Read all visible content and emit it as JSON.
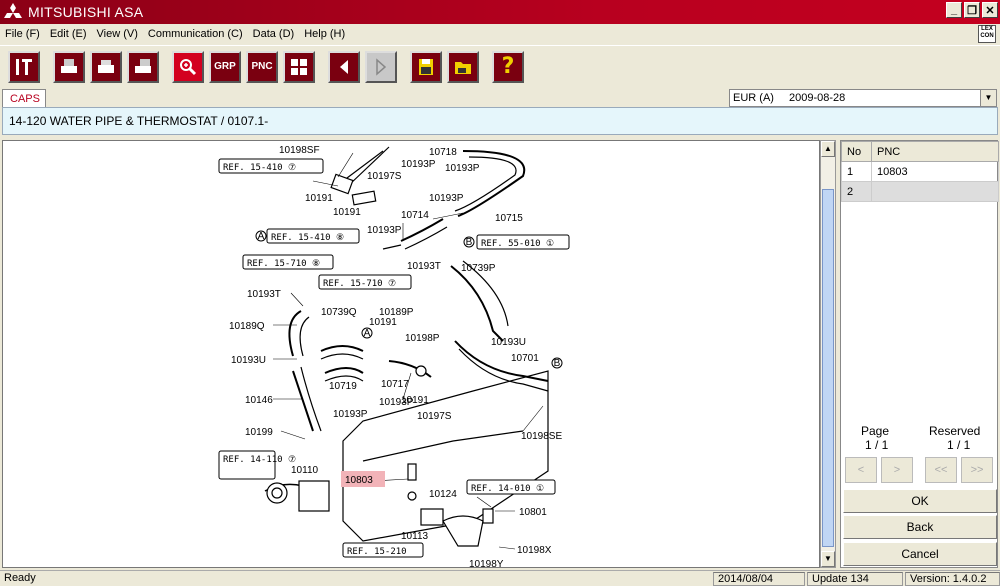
{
  "window": {
    "title": "MITSUBISHI ASA"
  },
  "menu": [
    "File (F)",
    "Edit (E)",
    "View (V)",
    "Communication (C)",
    "Data (D)",
    "Help (H)"
  ],
  "toolbar": {
    "grp_label": "GRP",
    "pnc_label": "PNC"
  },
  "lexcon": "LEX CON",
  "tab": {
    "label": "CAPS"
  },
  "region": {
    "value": "EUR (A)",
    "date": "2009-08-28"
  },
  "headline": "14-120  WATER PIPE & THERMOSTAT / 0107.1-",
  "illustration": {
    "labels": [
      "10198SF",
      "10718",
      "10193P",
      "10193P",
      "10197S",
      "10191",
      "10191",
      "10193P",
      "10714",
      "10715",
      "10193P",
      "10193T",
      "10739P",
      "10189Q",
      "10739Q",
      "10191",
      "10189P",
      "10193U",
      "10198P",
      "10193U",
      "10701",
      "10719",
      "10717",
      "10193P",
      "10191",
      "10146",
      "10193P",
      "10197S",
      "10198SE",
      "10199",
      "10110",
      "10803",
      "10124",
      "10801",
      "10113",
      "10198X",
      "10198Y",
      "10193T"
    ],
    "refs": [
      "REF. 15-410 ⑦",
      "REF. 15-410 ⑧",
      "REF. 15-710 ⑧",
      "REF. 15-710 ⑦",
      "REF. 55-010 ①",
      "REF. 14-110 ⑦",
      "REF. 14-010 ①",
      "REF. 15-210"
    ],
    "markers": [
      "A",
      "B",
      "A",
      "B"
    ]
  },
  "parts_table": {
    "headers": [
      "No",
      "PNC"
    ],
    "rows": [
      {
        "no": "1",
        "pnc": "10803"
      },
      {
        "no": "2",
        "pnc": ""
      }
    ]
  },
  "paging": {
    "page_label": "Page",
    "page_value": "1 / 1",
    "reserved_label": "Reserved",
    "reserved_value": "1 / 1"
  },
  "nav": {
    "prev": "<",
    "next": ">",
    "first": "<<",
    "last": ">>"
  },
  "buttons": {
    "ok": "OK",
    "back": "Back",
    "cancel": "Cancel"
  },
  "status": {
    "text": "Ready",
    "date": "2014/08/04",
    "update": "Update 134",
    "version": "Version: 1.4.0.2"
  },
  "colors": {
    "brand_red": "#b8001f",
    "highlight": "#f2b3b8",
    "header_bg": "#e5f6fb"
  }
}
